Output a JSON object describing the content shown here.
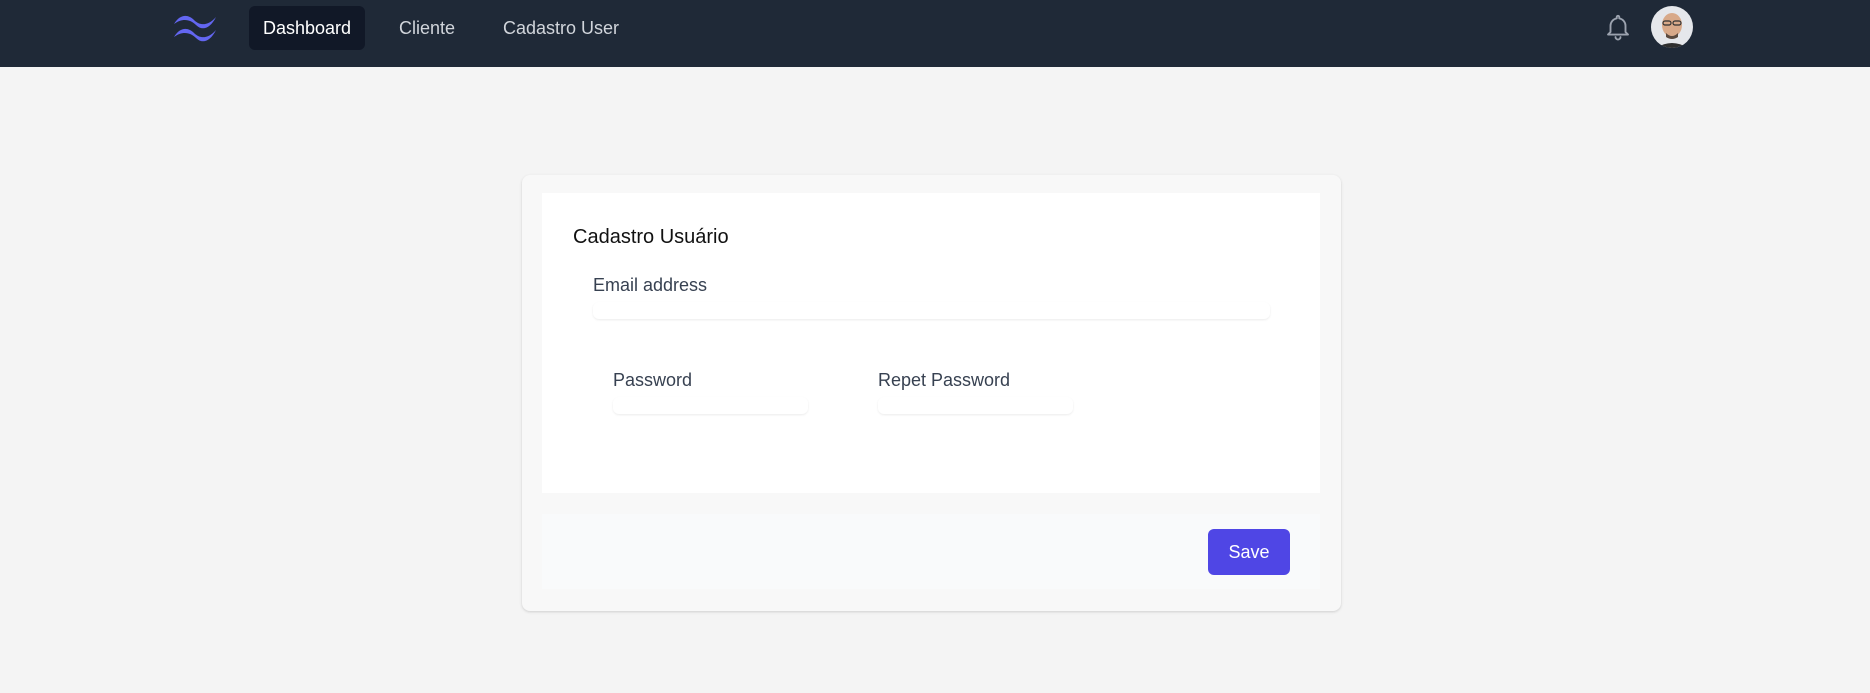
{
  "navbar": {
    "logo_icon": "tailwind-logo-icon",
    "links": [
      {
        "label": "Dashboard",
        "active": true
      },
      {
        "label": "Cliente",
        "active": false
      },
      {
        "label": "Cadastro User",
        "active": false
      }
    ],
    "notification_icon": "bell-icon",
    "avatar_icon": "user-avatar"
  },
  "form": {
    "title": "Cadastro Usuário",
    "email_label": "Email address",
    "email_value": "",
    "password_label": "Password",
    "password_value": "",
    "repeat_password_label": "Repet Password",
    "repeat_password_value": "",
    "save_label": "Save"
  },
  "colors": {
    "navbar_bg": "#1f2937",
    "nav_active_bg": "#111827",
    "page_bg": "#f4f4f4",
    "accent": "#4f46e5"
  }
}
